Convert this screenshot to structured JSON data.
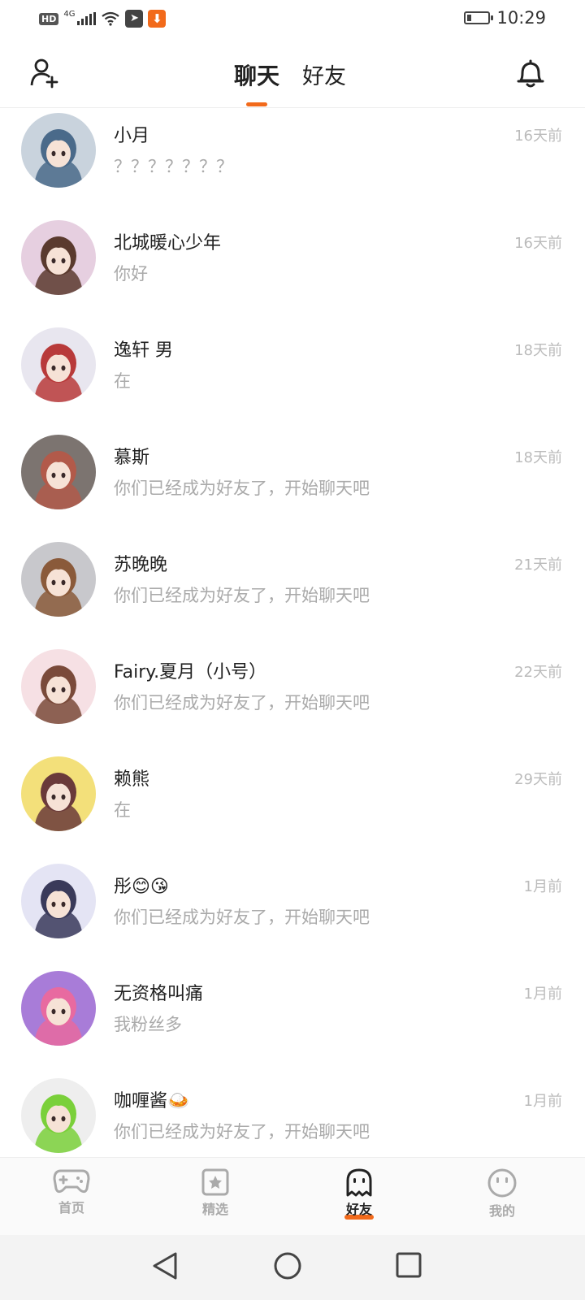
{
  "status_bar": {
    "hd": "HD",
    "network": "4G",
    "time": "10:29",
    "battery_level": 0.2
  },
  "header": {
    "tabs": [
      {
        "label": "聊天",
        "active": true
      },
      {
        "label": "好友",
        "active": false
      }
    ],
    "accent": "#f26a1b"
  },
  "chats": [
    {
      "name": "小月",
      "message": "？？？？？？？",
      "time": "16天前",
      "avatar_colors": [
        "#4a6a8a",
        "#c9d3dd"
      ]
    },
    {
      "name": "北城暖心少年",
      "message": "你好",
      "time": "16天前",
      "avatar_colors": [
        "#5a3a2e",
        "#e6cfe0"
      ]
    },
    {
      "name": "逸轩   男",
      "message": "在",
      "time": "18天前",
      "avatar_colors": [
        "#b83a3a",
        "#e8e6ef"
      ]
    },
    {
      "name": "慕斯",
      "message": "你们已经成为好友了，开始聊天吧",
      "time": "18天前",
      "avatar_colors": [
        "#b25a4a",
        "#7c7470"
      ]
    },
    {
      "name": "苏晚晚",
      "message": "你们已经成为好友了，开始聊天吧",
      "time": "21天前",
      "avatar_colors": [
        "#8a5a3a",
        "#c8c8cc"
      ]
    },
    {
      "name": "Fairy.夏月（小号）",
      "message": "你们已经成为好友了，开始聊天吧",
      "time": "22天前",
      "avatar_colors": [
        "#7a4a3a",
        "#f6e0e4"
      ]
    },
    {
      "name": "赖熊",
      "message": "在",
      "time": "29天前",
      "avatar_colors": [
        "#6a3a3a",
        "#f3e07a"
      ]
    },
    {
      "name": "彤😊😘",
      "message": "你们已经成为好友了，开始聊天吧",
      "time": "1月前",
      "avatar_colors": [
        "#3a3a5a",
        "#e4e4f4"
      ]
    },
    {
      "name": "无资格叫痛",
      "message": "我粉丝多",
      "time": "1月前",
      "avatar_colors": [
        "#e86aa0",
        "#a87cd8"
      ]
    },
    {
      "name": "咖喱酱🍛",
      "message": "你们已经成为好友了，开始聊天吧",
      "time": "1月前",
      "avatar_colors": [
        "#7ad03a",
        "#eeeeee"
      ]
    }
  ],
  "bottom_nav": [
    {
      "label": "首页",
      "icon": "gamepad-icon",
      "active": false
    },
    {
      "label": "精选",
      "icon": "star-card-icon",
      "active": false
    },
    {
      "label": "好友",
      "icon": "ghost-icon",
      "active": true
    },
    {
      "label": "我的",
      "icon": "face-icon",
      "active": false
    }
  ]
}
